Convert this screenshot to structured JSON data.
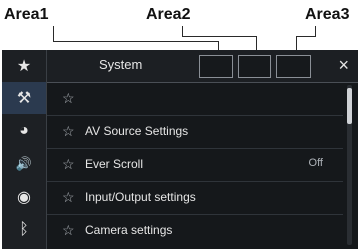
{
  "callouts": {
    "area1": "Area1",
    "area2": "Area2",
    "area3": "Area3"
  },
  "header": {
    "title": "System",
    "close_glyph": "×"
  },
  "sidebar": [
    {
      "icon": "star-icon",
      "glyph": "★"
    },
    {
      "icon": "settings-tools-icon",
      "glyph": "⚒",
      "active": true
    },
    {
      "icon": "theme-palette-icon",
      "glyph": "◕"
    },
    {
      "icon": "speaker-icon",
      "glyph": "🔊"
    },
    {
      "icon": "disc-icon",
      "glyph": "◉"
    },
    {
      "icon": "bluetooth-icon",
      "glyph": "ᛒ"
    }
  ],
  "list": [
    {
      "label": "",
      "value": ""
    },
    {
      "label": "AV Source Settings",
      "value": ""
    },
    {
      "label": "Ever Scroll",
      "value": "Off"
    },
    {
      "label": "Input/Output settings",
      "value": ""
    },
    {
      "label": "Camera settings",
      "value": ""
    }
  ],
  "star_glyph": "☆"
}
